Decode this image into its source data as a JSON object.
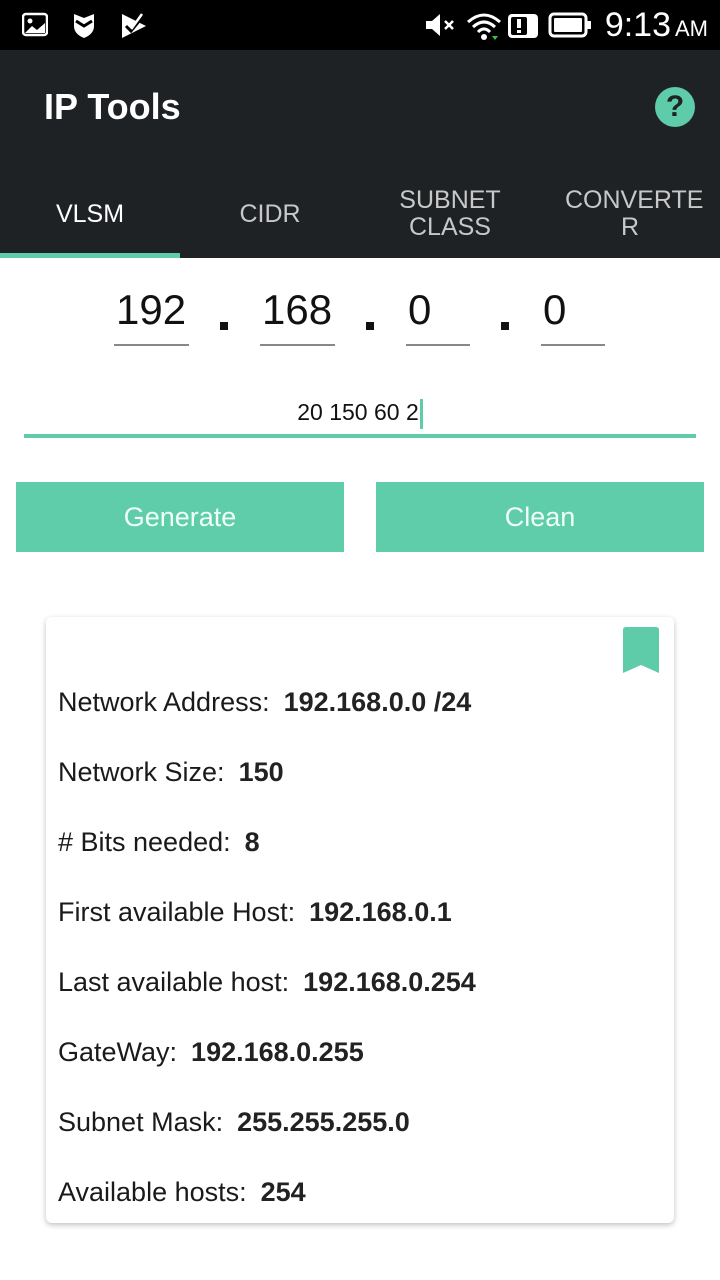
{
  "status_bar": {
    "left_icons": [
      "gallery-icon",
      "shield-icon",
      "play-check-icon"
    ],
    "right_icons": [
      "mute-icon",
      "wifi-icon",
      "alert-icon",
      "battery-icon"
    ],
    "time": "9:13",
    "ampm": "AM"
  },
  "app": {
    "title": "IP Tools",
    "help_label": "?",
    "accent_color": "#5ecca8",
    "toolbar_color": "#1f2225"
  },
  "tabs": [
    {
      "label": "VLSM",
      "active": true
    },
    {
      "label": "CIDR",
      "active": false
    },
    {
      "label": "SUBNET CLASS",
      "active": false
    },
    {
      "label": "CONVERTE R",
      "active": false
    }
  ],
  "ip_input": {
    "octets": [
      "192",
      "168",
      "0",
      "0"
    ],
    "separator": "."
  },
  "sizes_input": {
    "value": "20 150 60 2"
  },
  "buttons": {
    "generate": "Generate",
    "clean": "Clean"
  },
  "result": {
    "rows": [
      {
        "label": "Network Address:",
        "value": "192.168.0.0 /24"
      },
      {
        "label": "Network Size:",
        "value": "150"
      },
      {
        "label": "# Bits needed:",
        "value": "8"
      },
      {
        "label": "First available Host:",
        "value": "192.168.0.1"
      },
      {
        "label": "Last available host:",
        "value": "192.168.0.254"
      },
      {
        "label": "GateWay:",
        "value": "192.168.0.255"
      },
      {
        "label": "Subnet Mask:",
        "value": "255.255.255.0"
      },
      {
        "label": "Available hosts:",
        "value": "254"
      }
    ]
  }
}
